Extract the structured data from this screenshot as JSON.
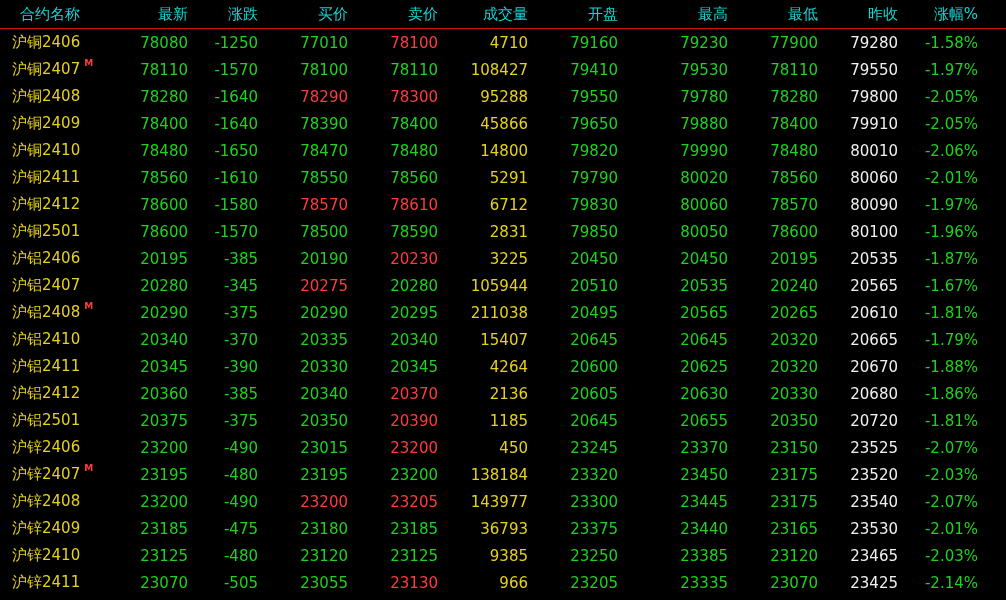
{
  "columns": [
    "合约名称",
    "最新",
    "涨跌",
    "买价",
    "卖价",
    "成交量",
    "开盘",
    "最高",
    "最低",
    "昨收",
    "涨幅%"
  ],
  "rows": [
    {
      "name": "沪铜2406",
      "last": "78080",
      "change": "-1250",
      "bid": {
        "value": "77010",
        "up": false
      },
      "ask": {
        "value": "78100",
        "up": true
      },
      "volume": "4710",
      "open": "79160",
      "high": "79230",
      "low": "77900",
      "prev": "79280",
      "pct": "-1.58%"
    },
    {
      "name": "沪铜2407",
      "marker": "M",
      "last": "78110",
      "change": "-1570",
      "bid": {
        "value": "78100",
        "up": false
      },
      "ask": {
        "value": "78110",
        "up": false
      },
      "volume": "108427",
      "open": "79410",
      "high": "79530",
      "low": "78110",
      "prev": "79550",
      "pct": "-1.97%"
    },
    {
      "name": "沪铜2408",
      "last": "78280",
      "change": "-1640",
      "bid": {
        "value": "78290",
        "up": true
      },
      "ask": {
        "value": "78300",
        "up": true
      },
      "volume": "95288",
      "open": "79550",
      "high": "79780",
      "low": "78280",
      "prev": "79800",
      "pct": "-2.05%"
    },
    {
      "name": "沪铜2409",
      "last": "78400",
      "change": "-1640",
      "bid": {
        "value": "78390",
        "up": false
      },
      "ask": {
        "value": "78400",
        "up": false
      },
      "volume": "45866",
      "open": "79650",
      "high": "79880",
      "low": "78400",
      "prev": "79910",
      "pct": "-2.05%"
    },
    {
      "name": "沪铜2410",
      "last": "78480",
      "change": "-1650",
      "bid": {
        "value": "78470",
        "up": false
      },
      "ask": {
        "value": "78480",
        "up": false
      },
      "volume": "14800",
      "open": "79820",
      "high": "79990",
      "low": "78480",
      "prev": "80010",
      "pct": "-2.06%"
    },
    {
      "name": "沪铜2411",
      "last": "78560",
      "change": "-1610",
      "bid": {
        "value": "78550",
        "up": false
      },
      "ask": {
        "value": "78560",
        "up": false
      },
      "volume": "5291",
      "open": "79790",
      "high": "80020",
      "low": "78560",
      "prev": "80060",
      "pct": "-2.01%"
    },
    {
      "name": "沪铜2412",
      "last": "78600",
      "change": "-1580",
      "bid": {
        "value": "78570",
        "up": true
      },
      "ask": {
        "value": "78610",
        "up": true
      },
      "volume": "6712",
      "open": "79830",
      "high": "80060",
      "low": "78570",
      "prev": "80090",
      "pct": "-1.97%"
    },
    {
      "name": "沪铜2501",
      "last": "78600",
      "change": "-1570",
      "bid": {
        "value": "78500",
        "up": false
      },
      "ask": {
        "value": "78590",
        "up": false
      },
      "volume": "2831",
      "open": "79850",
      "high": "80050",
      "low": "78600",
      "prev": "80100",
      "pct": "-1.96%"
    },
    {
      "name": "沪铝2406",
      "last": "20195",
      "change": "-385",
      "bid": {
        "value": "20190",
        "up": false
      },
      "ask": {
        "value": "20230",
        "up": true
      },
      "volume": "3225",
      "open": "20450",
      "high": "20450",
      "low": "20195",
      "prev": "20535",
      "pct": "-1.87%"
    },
    {
      "name": "沪铝2407",
      "last": "20280",
      "change": "-345",
      "bid": {
        "value": "20275",
        "up": true
      },
      "ask": {
        "value": "20280",
        "up": false
      },
      "volume": "105944",
      "open": "20510",
      "high": "20535",
      "low": "20240",
      "prev": "20565",
      "pct": "-1.67%"
    },
    {
      "name": "沪铝2408",
      "marker": "M",
      "last": "20290",
      "change": "-375",
      "bid": {
        "value": "20290",
        "up": false
      },
      "ask": {
        "value": "20295",
        "up": false
      },
      "volume": "211038",
      "open": "20495",
      "high": "20565",
      "low": "20265",
      "prev": "20610",
      "pct": "-1.81%"
    },
    {
      "name": "沪铝2410",
      "last": "20340",
      "change": "-370",
      "bid": {
        "value": "20335",
        "up": false
      },
      "ask": {
        "value": "20340",
        "up": false
      },
      "volume": "15407",
      "open": "20645",
      "high": "20645",
      "low": "20320",
      "prev": "20665",
      "pct": "-1.79%"
    },
    {
      "name": "沪铝2411",
      "last": "20345",
      "change": "-390",
      "bid": {
        "value": "20330",
        "up": false
      },
      "ask": {
        "value": "20345",
        "up": false
      },
      "volume": "4264",
      "open": "20600",
      "high": "20625",
      "low": "20320",
      "prev": "20670",
      "pct": "-1.88%"
    },
    {
      "name": "沪铝2412",
      "last": "20360",
      "change": "-385",
      "bid": {
        "value": "20340",
        "up": false
      },
      "ask": {
        "value": "20370",
        "up": true
      },
      "volume": "2136",
      "open": "20605",
      "high": "20630",
      "low": "20330",
      "prev": "20680",
      "pct": "-1.86%"
    },
    {
      "name": "沪铝2501",
      "last": "20375",
      "change": "-375",
      "bid": {
        "value": "20350",
        "up": false
      },
      "ask": {
        "value": "20390",
        "up": true
      },
      "volume": "1185",
      "open": "20645",
      "high": "20655",
      "low": "20350",
      "prev": "20720",
      "pct": "-1.81%"
    },
    {
      "name": "沪锌2406",
      "last": "23200",
      "change": "-490",
      "bid": {
        "value": "23015",
        "up": false
      },
      "ask": {
        "value": "23200",
        "up": true
      },
      "volume": "450",
      "open": "23245",
      "high": "23370",
      "low": "23150",
      "prev": "23525",
      "pct": "-2.07%"
    },
    {
      "name": "沪锌2407",
      "marker": "M",
      "last": "23195",
      "change": "-480",
      "bid": {
        "value": "23195",
        "up": false
      },
      "ask": {
        "value": "23200",
        "up": false
      },
      "volume": "138184",
      "open": "23320",
      "high": "23450",
      "low": "23175",
      "prev": "23520",
      "pct": "-2.03%"
    },
    {
      "name": "沪锌2408",
      "last": "23200",
      "change": "-490",
      "bid": {
        "value": "23200",
        "up": true
      },
      "ask": {
        "value": "23205",
        "up": true
      },
      "volume": "143977",
      "open": "23300",
      "high": "23445",
      "low": "23175",
      "prev": "23540",
      "pct": "-2.07%"
    },
    {
      "name": "沪锌2409",
      "last": "23185",
      "change": "-475",
      "bid": {
        "value": "23180",
        "up": false
      },
      "ask": {
        "value": "23185",
        "up": false
      },
      "volume": "36793",
      "open": "23375",
      "high": "23440",
      "low": "23165",
      "prev": "23530",
      "pct": "-2.01%"
    },
    {
      "name": "沪锌2410",
      "last": "23125",
      "change": "-480",
      "bid": {
        "value": "23120",
        "up": false
      },
      "ask": {
        "value": "23125",
        "up": false
      },
      "volume": "9385",
      "open": "23250",
      "high": "23385",
      "low": "23120",
      "prev": "23465",
      "pct": "-2.03%"
    },
    {
      "name": "沪锌2411",
      "last": "23070",
      "change": "-505",
      "bid": {
        "value": "23055",
        "up": false
      },
      "ask": {
        "value": "23130",
        "up": true
      },
      "volume": "966",
      "open": "23205",
      "high": "23335",
      "low": "23070",
      "prev": "23425",
      "pct": "-2.14%"
    }
  ]
}
